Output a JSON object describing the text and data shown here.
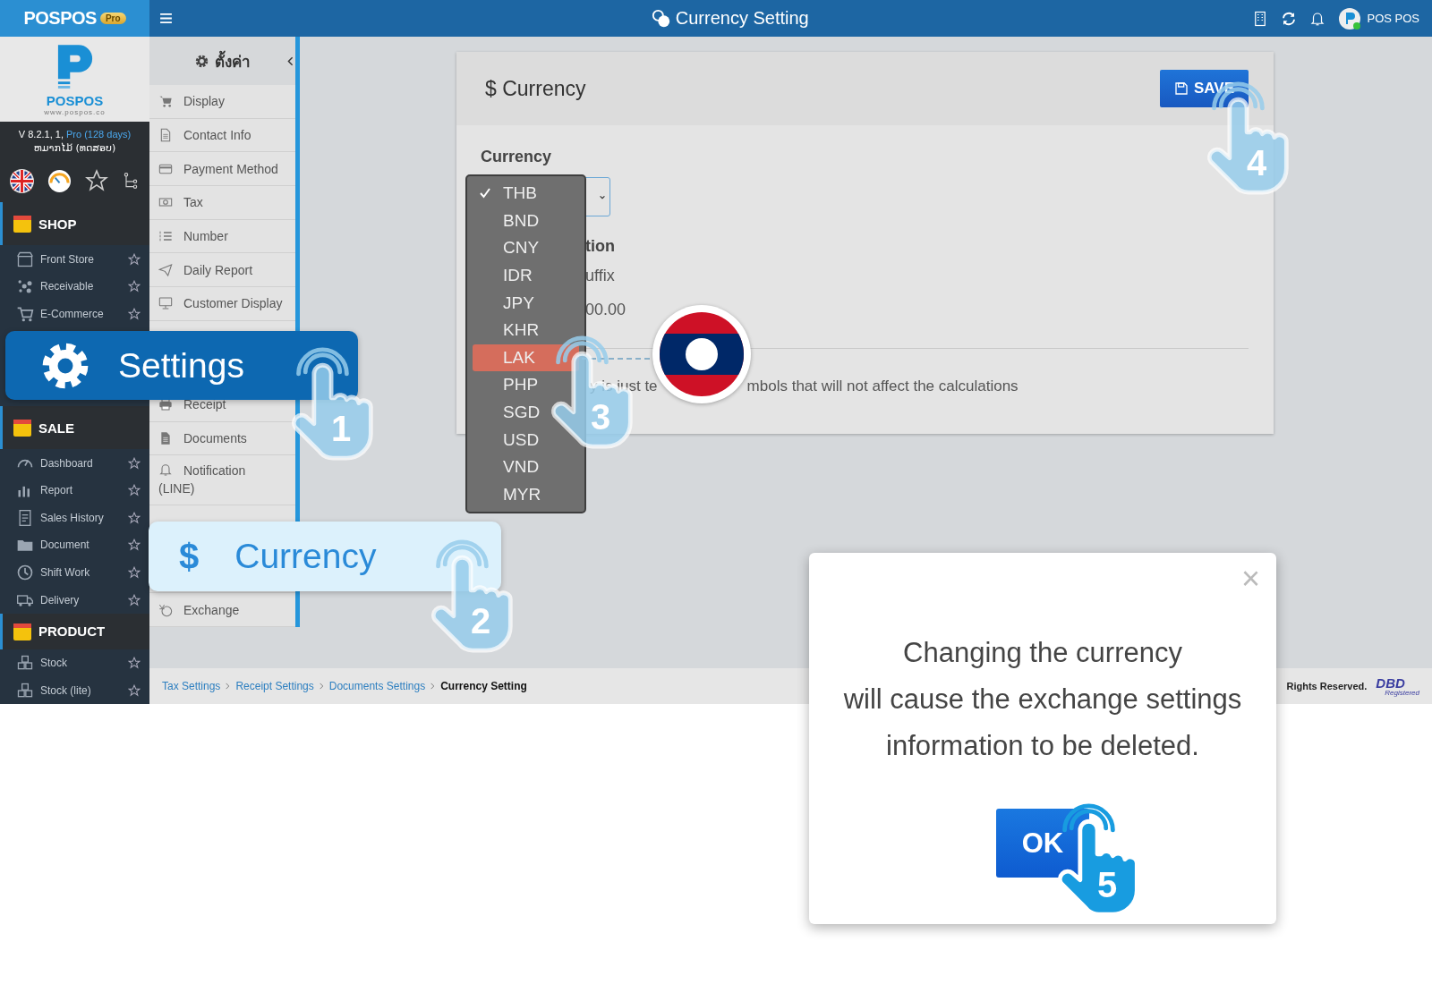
{
  "topbar": {
    "logo": "POSPOS",
    "badge": "Pro",
    "title": "Currency Setting",
    "user": "POS POS"
  },
  "sidebar": {
    "brand": "POSPOS",
    "brand_url": "www.pospos.co",
    "version": "V 8.2.1, 1,",
    "plan": "Pro (128 days)",
    "shop_name": "ຫມາກໄມ້ (ທດສອບ)",
    "sections": [
      {
        "title": "SHOP",
        "items": [
          "Front Store",
          "Receivable",
          "E-Commerce"
        ]
      },
      {
        "title": "SALE",
        "items": [
          "Dashboard",
          "Report",
          "Sales History",
          "Document",
          "Shift Work",
          "Delivery"
        ]
      },
      {
        "title": "PRODUCT",
        "items": [
          "Stock",
          "Stock (lite)"
        ]
      }
    ]
  },
  "settings_menu": {
    "title": "ตั้งค่า",
    "groups": [
      [
        "Display",
        "Contact Info",
        "Payment Method",
        "Tax",
        "Number",
        "Daily Report",
        "Customer Display"
      ],
      [
        "Receipt",
        "Documents",
        "Notification (LINE)"
      ],
      [
        "Exchange"
      ]
    ]
  },
  "card": {
    "title": "$ Currency",
    "save": "SAVE",
    "currency_label": "Currency",
    "fragments": [
      "tion",
      "uffix",
      "00.00"
    ],
    "note_start": "y is just te",
    "note_end": "mbols that will not affect the calculations"
  },
  "dropdown": [
    {
      "label": "THB",
      "selected": true,
      "highlighted": false
    },
    {
      "label": "BND",
      "selected": false,
      "highlighted": false
    },
    {
      "label": "CNY",
      "selected": false,
      "highlighted": false
    },
    {
      "label": "IDR",
      "selected": false,
      "highlighted": false
    },
    {
      "label": "JPY",
      "selected": false,
      "highlighted": false
    },
    {
      "label": "KHR",
      "selected": false,
      "highlighted": false
    },
    {
      "label": "LAK",
      "selected": false,
      "highlighted": true
    },
    {
      "label": "PHP",
      "selected": false,
      "highlighted": false
    },
    {
      "label": "SGD",
      "selected": false,
      "highlighted": false
    },
    {
      "label": "USD",
      "selected": false,
      "highlighted": false
    },
    {
      "label": "VND",
      "selected": false,
      "highlighted": false
    },
    {
      "label": "MYR",
      "selected": false,
      "highlighted": false
    }
  ],
  "breadcrumbs": [
    {
      "label": "Tax Settings",
      "selected": false
    },
    {
      "label": "Receipt Settings",
      "selected": false
    },
    {
      "label": "Documents Settings",
      "selected": false
    },
    {
      "label": "Currency Setting",
      "selected": true
    }
  ],
  "footer": {
    "rights": "Rights Reserved.",
    "logo": "DBD",
    "logo_sub": "Registered"
  },
  "callouts": [
    {
      "label": "Settings"
    },
    {
      "label": "Currency",
      "prefix": "$"
    }
  ],
  "steps": [
    {
      "number": "1",
      "kind": "faded"
    },
    {
      "number": "2",
      "kind": "faded"
    },
    {
      "number": "3",
      "kind": "faded"
    },
    {
      "number": "4",
      "kind": "faded"
    },
    {
      "number": "5",
      "kind": "solid"
    }
  ],
  "dialog": {
    "close": "×",
    "lines": [
      "Changing the currency",
      "will cause the exchange settings",
      "information to be deleted."
    ],
    "ok": "OK"
  }
}
